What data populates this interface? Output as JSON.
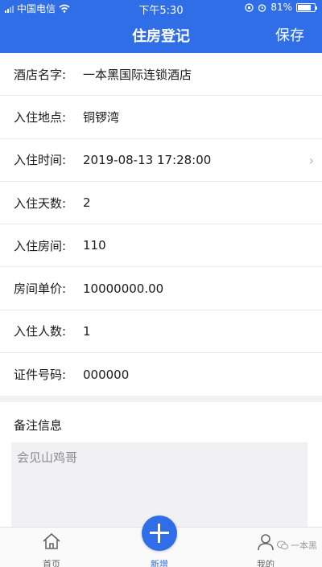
{
  "status_bar": {
    "carrier": "中国电信",
    "time": "下午5:30",
    "battery": "81%",
    "battery_level": 0.81
  },
  "navbar": {
    "title": "住房登记",
    "save_label": "保存"
  },
  "form": {
    "rows": [
      {
        "label": "酒店名字:",
        "value": "一本黑国际连锁酒店"
      },
      {
        "label": "入住地点:",
        "value": "铜锣湾"
      },
      {
        "label": "入住时间:",
        "value": "2019-08-13 17:28:00"
      },
      {
        "label": "入住天数:",
        "value": "2"
      },
      {
        "label": "入住房间:",
        "value": "110"
      },
      {
        "label": "房间单价:",
        "value": "10000000.00"
      },
      {
        "label": "入住人数:",
        "value": "1"
      },
      {
        "label": "证件号码:",
        "value": "000000"
      }
    ]
  },
  "remarks": {
    "heading": "备注信息",
    "value": "会见山鸡哥"
  },
  "tabbar": {
    "home": "首页",
    "add": "新增",
    "mine": "我的"
  },
  "watermark": "一本黑",
  "colors": {
    "primary": "#2f6ee6"
  }
}
